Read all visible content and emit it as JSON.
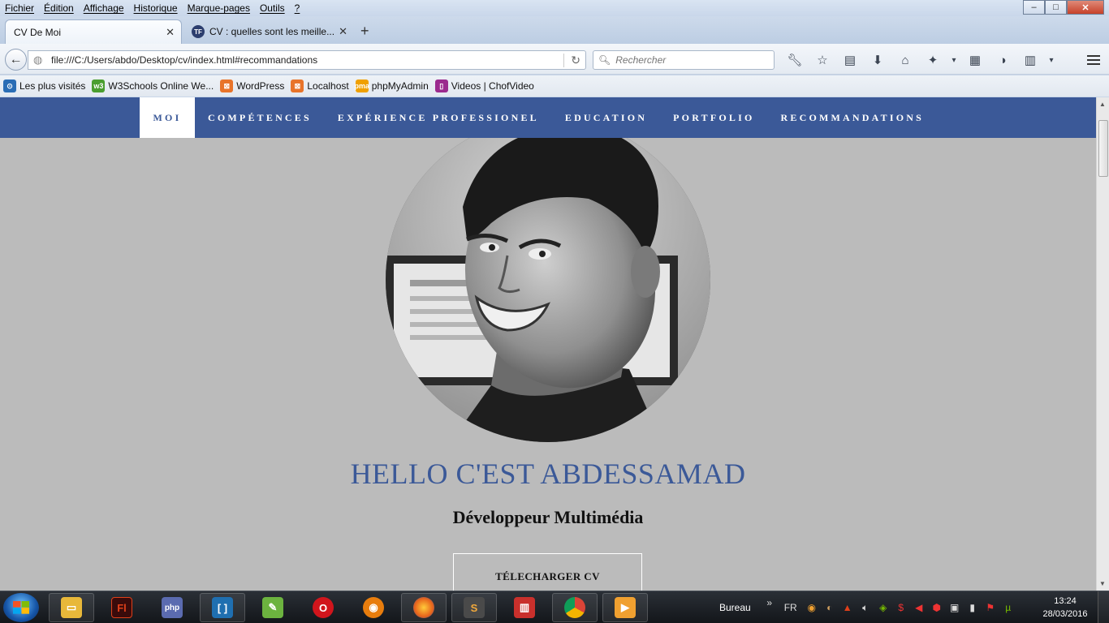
{
  "menubar": {
    "items": [
      "Fichier",
      "Édition",
      "Affichage",
      "Historique",
      "Marque-pages",
      "Outils",
      "?"
    ]
  },
  "window_controls": {
    "minimize": "–",
    "maximize": "□",
    "close": "✕"
  },
  "tabs": [
    {
      "label": "CV De Moi",
      "active": true
    },
    {
      "label": "CV : quelles sont les meille...",
      "active": false,
      "favicon_text": "TF"
    }
  ],
  "newtab_label": "+",
  "navbar": {
    "url": "file:///C:/Users/abdo/Desktop/cv/index.html#recommandations",
    "search_placeholder": "Rechercher",
    "icons": [
      "wrench-icon",
      "star-icon",
      "reading-list-icon",
      "download-icon",
      "home-icon",
      "plugin-icon",
      "dropdown-icon",
      "grid-icon",
      "extension-icon",
      "clipboard-icon",
      "dropdown-icon",
      "menu-icon"
    ]
  },
  "bookmarks": [
    {
      "label": "Les plus visités",
      "color": "#2a6db5"
    },
    {
      "label": "W3Schools Online We...",
      "color": "#4a9e2f"
    },
    {
      "label": "WordPress",
      "color": "#e8742a"
    },
    {
      "label": "Localhost",
      "color": "#e8742a"
    },
    {
      "label": "phpMyAdmin",
      "color": "#f0a000"
    },
    {
      "label": "Videos | ChofVideo",
      "color": "#9b2a8e"
    }
  ],
  "site": {
    "nav": [
      "MOI",
      "COMPÉTENCES",
      "EXPÉRIENCE PROFESSIONEL",
      "EDUCATION",
      "PORTFOLIO",
      "RECOMMANDATIONS"
    ],
    "active_nav": "MOI",
    "accent_color": "#3b5998",
    "background_color": "#bbbbbb",
    "hello": "HELLO C'EST ABDESSAMAD",
    "role": "Développeur Multimédia",
    "download_button": "TÉLECHARGER CV"
  },
  "taskbar": {
    "apps": [
      {
        "name": "explorer-icon",
        "color": "#e8b83a"
      },
      {
        "name": "flash-icon",
        "label": "Fl",
        "color": "#3a0b0b"
      },
      {
        "name": "php-icon",
        "label": "php",
        "color": "#5b6bb0"
      },
      {
        "name": "brackets-icon",
        "color": "#1f6fb0"
      },
      {
        "name": "notepadpp-icon",
        "color": "#6cb33f"
      },
      {
        "name": "opera-icon",
        "color": "#d1151c"
      },
      {
        "name": "blender-icon",
        "color": "#e87d0d"
      },
      {
        "name": "firefox-icon",
        "color": "#e8641b"
      },
      {
        "name": "sublime-icon",
        "label": "S",
        "color": "#4a4a4a"
      },
      {
        "name": "popcorn-icon",
        "color": "#c9302c"
      },
      {
        "name": "chrome-icon",
        "color": "#2e9e4a"
      },
      {
        "name": "video-player-icon",
        "color": "#f0a030"
      }
    ],
    "tray_label": "Bureau",
    "tray_expand": "»",
    "language": "FR",
    "time": "13:24",
    "date": "28/03/2016"
  }
}
